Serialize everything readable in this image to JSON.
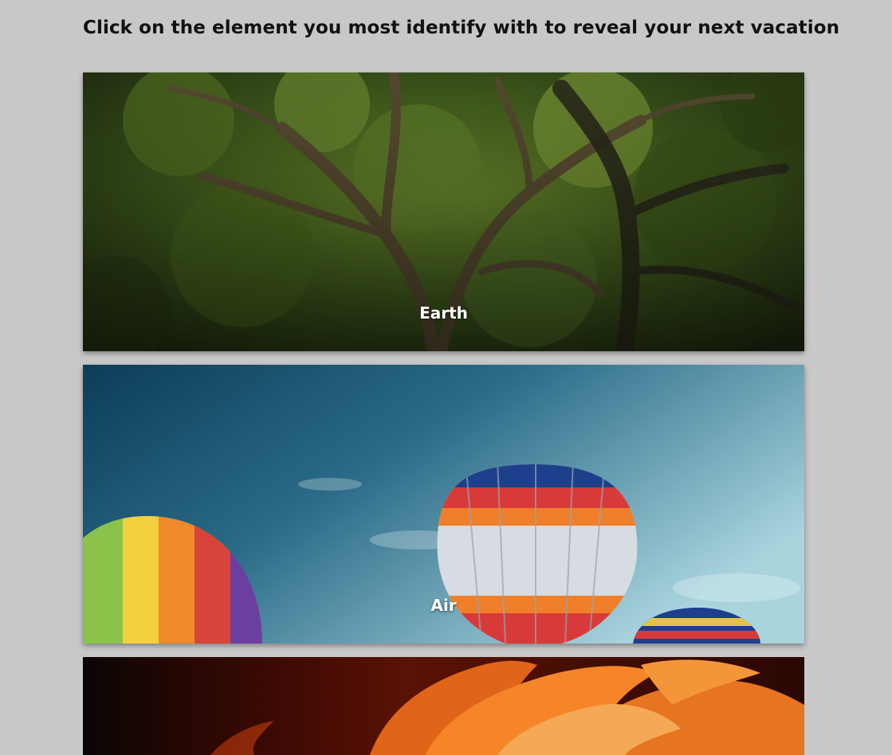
{
  "heading": "Click on the element you most identify with to reveal your next vacation",
  "cards": [
    {
      "label": "Earth",
      "image": "tree-canopy-photo"
    },
    {
      "label": "Air",
      "image": "hot-air-balloons-photo"
    },
    {
      "label": "",
      "image": "fire-flames-photo"
    }
  ],
  "colors": {
    "background": "#c8c8c8",
    "heading_text": "#111111",
    "label_text": "#ffffff"
  }
}
